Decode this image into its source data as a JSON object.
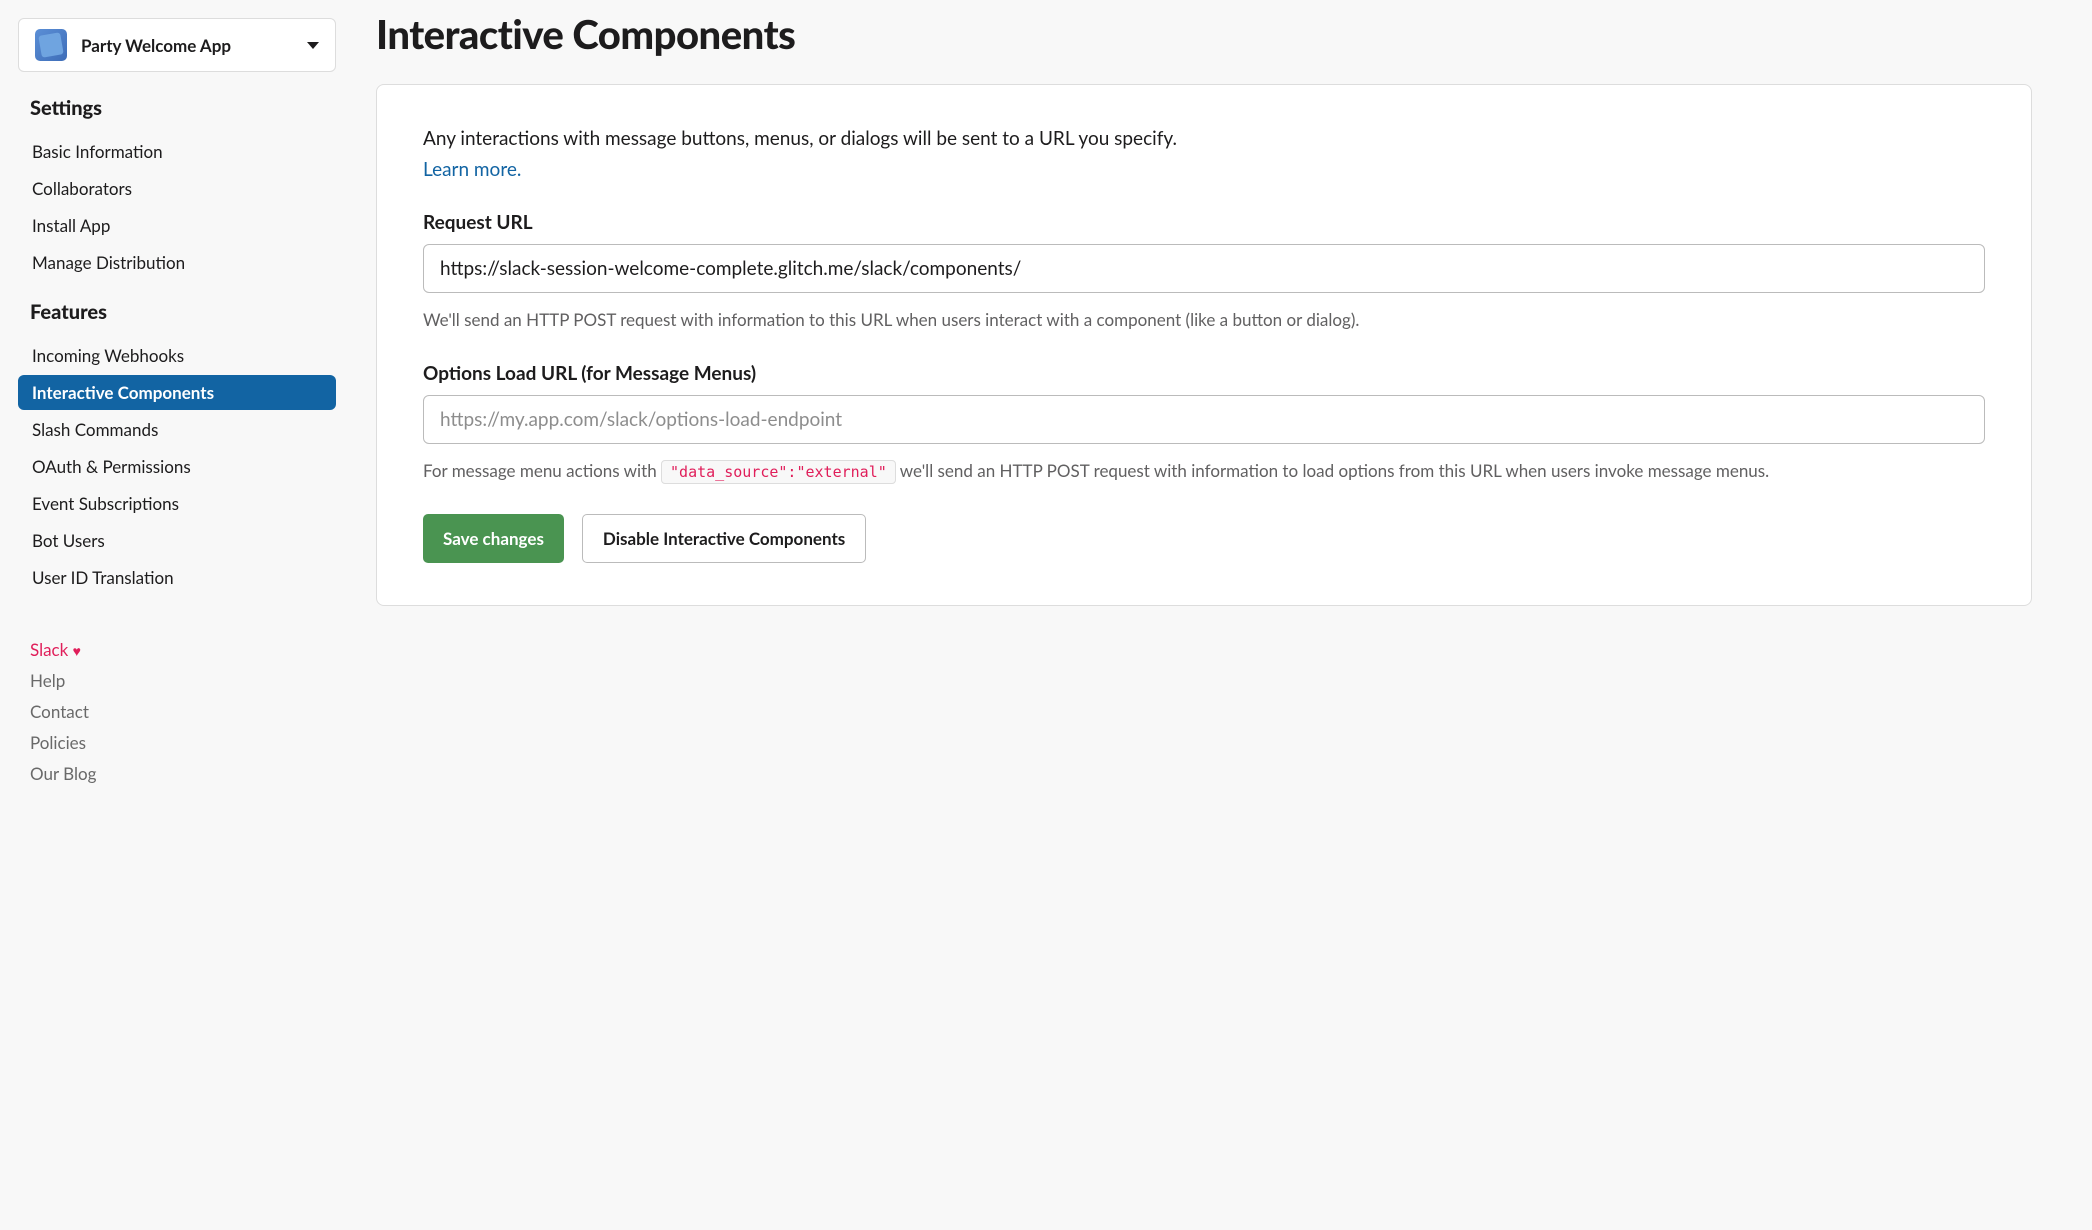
{
  "app_selector": {
    "name": "Party Welcome App"
  },
  "sidebar": {
    "settings_header": "Settings",
    "features_header": "Features",
    "settings": [
      {
        "label": "Basic Information",
        "active": false
      },
      {
        "label": "Collaborators",
        "active": false
      },
      {
        "label": "Install App",
        "active": false
      },
      {
        "label": "Manage Distribution",
        "active": false
      }
    ],
    "features": [
      {
        "label": "Incoming Webhooks",
        "active": false
      },
      {
        "label": "Interactive Components",
        "active": true
      },
      {
        "label": "Slash Commands",
        "active": false
      },
      {
        "label": "OAuth & Permissions",
        "active": false
      },
      {
        "label": "Event Subscriptions",
        "active": false
      },
      {
        "label": "Bot Users",
        "active": false
      },
      {
        "label": "User ID Translation",
        "active": false
      }
    ],
    "footer": {
      "slack": "Slack",
      "help": "Help",
      "contact": "Contact",
      "policies": "Policies",
      "blog": "Our Blog"
    }
  },
  "main": {
    "title": "Interactive Components",
    "intro": "Any interactions with message buttons, menus, or dialogs will be sent to a URL you specify.",
    "learn_more": "Learn more.",
    "request_url": {
      "label": "Request URL",
      "value": "https://slack-session-welcome-complete.glitch.me/slack/components/",
      "help": "We'll send an HTTP POST request with information to this URL when users interact with a component (like a button or dialog)."
    },
    "options_url": {
      "label": "Options Load URL (for Message Menus)",
      "placeholder": "https://my.app.com/slack/options-load-endpoint",
      "value": "",
      "help_pre": "For message menu actions with ",
      "help_code": "\"data_source\":\"external\"",
      "help_post": " we'll send an HTTP POST request with information to load options from this URL when users invoke message menus."
    },
    "buttons": {
      "save": "Save changes",
      "disable": "Disable Interactive Components"
    }
  }
}
